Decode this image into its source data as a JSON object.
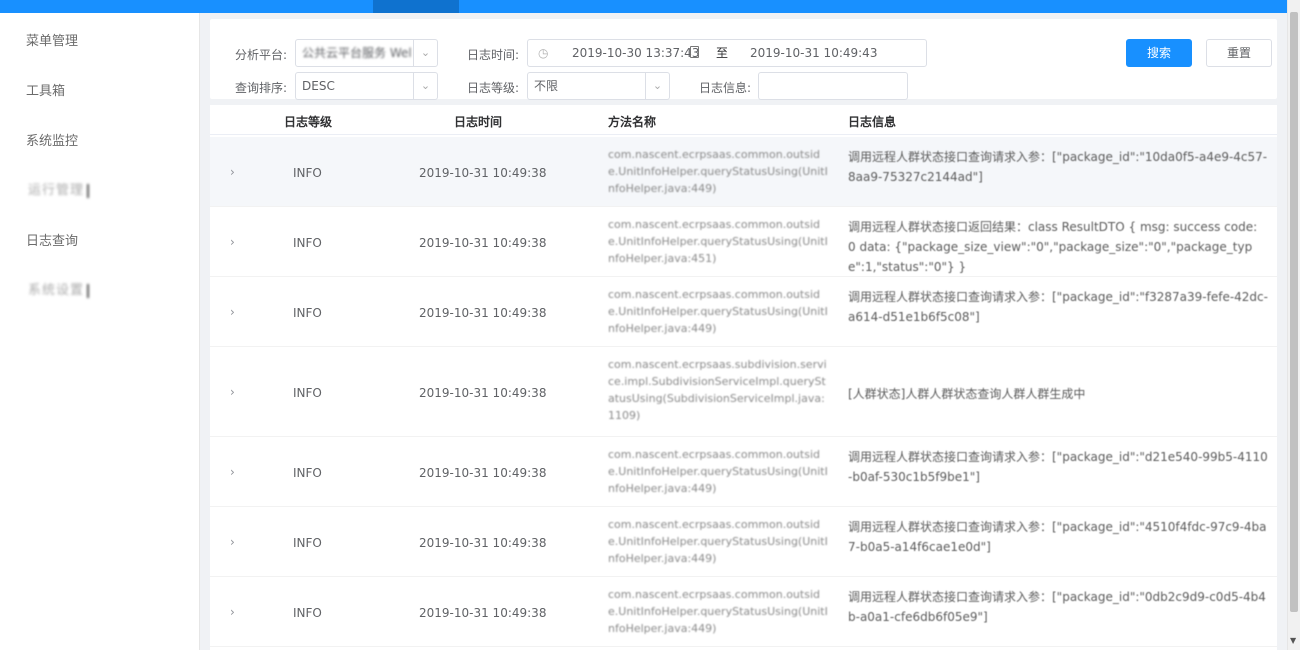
{
  "sidebar": {
    "items": [
      {
        "label": "菜单管理"
      },
      {
        "label": "工具箱"
      },
      {
        "label": "系统监控"
      },
      {
        "label": "运行管理"
      },
      {
        "label": "日志查询"
      },
      {
        "label": "系统设置"
      }
    ]
  },
  "filters": {
    "platform_label": "分析平台:",
    "platform_value": "公共云平台服务 Wel",
    "order_label": "查询排序:",
    "order_value": "DESC",
    "log_time_label": "日志时间:",
    "date_start": "2019-10-30 13:37:43",
    "date_sep": "至",
    "date_end": "2019-10-31 10:49:43",
    "log_level_label": "日志等级:",
    "log_level_value": "不限",
    "log_info_label": "日志信息:",
    "log_info_value": "",
    "search_button": "搜索",
    "reset_button": "重置"
  },
  "table": {
    "columns": [
      "日志等级",
      "日志时间",
      "方法名称",
      "日志信息"
    ],
    "rows": [
      {
        "level": "INFO",
        "time": "2019-10-31 10:49:38",
        "method": "com.nascent.ecrpsaas.common.outside.UnitInfoHelper.queryStatusUsing(UnitInfoHelper.java:449)",
        "info": "调用远程人群状态接口查询请求入参：[\"package_id\":\"10da0f5-a4e9-4c57-8aa9-75327c2144ad\"]"
      },
      {
        "level": "INFO",
        "time": "2019-10-31 10:49:38",
        "method": "com.nascent.ecrpsaas.common.outside.UnitInfoHelper.queryStatusUsing(UnitInfoHelper.java:451)",
        "info": "调用远程人群状态接口返回结果：class ResultDTO { msg: success code: 0 data: {\"package_size_view\":\"0\",\"package_size\":\"0\",\"package_type\":1,\"status\":\"0\"} }"
      },
      {
        "level": "INFO",
        "time": "2019-10-31 10:49:38",
        "method": "com.nascent.ecrpsaas.common.outside.UnitInfoHelper.queryStatusUsing(UnitInfoHelper.java:449)",
        "info": "调用远程人群状态接口查询请求入参：[\"package_id\":\"f3287a39-fefe-42dc-a614-d51e1b6f5c08\"]"
      },
      {
        "level": "INFO",
        "time": "2019-10-31 10:49:38",
        "method": "com.nascent.ecrpsaas.subdivision.service.impl.SubdivisionServiceImpl.queryStatusUsing(SubdivisionServiceImpl.java:1109)",
        "info": "[人群状态]人群人群状态查询人群人群生成中"
      },
      {
        "level": "INFO",
        "time": "2019-10-31 10:49:38",
        "method": "com.nascent.ecrpsaas.common.outside.UnitInfoHelper.queryStatusUsing(UnitInfoHelper.java:449)",
        "info": "调用远程人群状态接口查询请求入参：[\"package_id\":\"d21e540-99b5-4110-b0af-530c1b5f9be1\"]"
      },
      {
        "level": "INFO",
        "time": "2019-10-31 10:49:38",
        "method": "com.nascent.ecrpsaas.common.outside.UnitInfoHelper.queryStatusUsing(UnitInfoHelper.java:449)",
        "info": "调用远程人群状态接口查询请求入参：[\"package_id\":\"4510f4fdc-97c9-4ba7-b0a5-a14f6cae1e0d\"]"
      },
      {
        "level": "INFO",
        "time": "2019-10-31 10:49:38",
        "method": "com.nascent.ecrpsaas.common.outside.UnitInfoHelper.queryStatusUsing(UnitInfoHelper.java:449)",
        "info": "调用远程人群状态接口查询请求入参：[\"package_id\":\"0db2c9d9-c0d5-4b4b-a0a1-cfe6db6f05e9\"]"
      }
    ]
  },
  "icons": {
    "expand": "chevron-right-icon",
    "dropdown": "chevron-down-icon",
    "clock": "clock-icon",
    "calendar": "calendar-icon"
  },
  "colors": {
    "primary": "#1890ff",
    "sidebar_bg": "#ffffff",
    "main_bg": "#f0f2f5",
    "highlight_row": "#f5f7fa"
  }
}
